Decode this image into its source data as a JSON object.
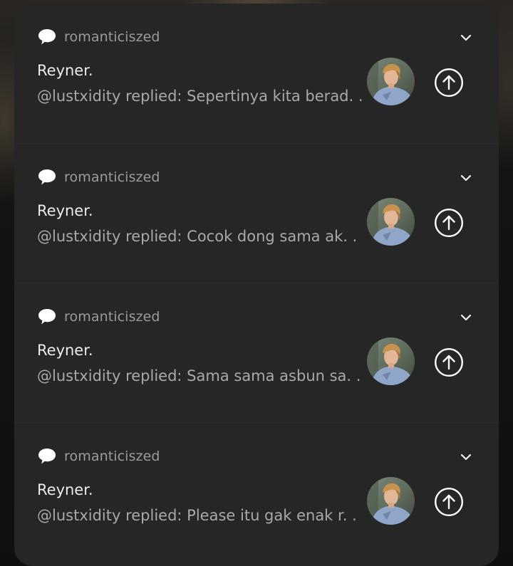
{
  "notifications": [
    {
      "app_name": "romanticiszed",
      "app_icon": "speech-bubble-icon",
      "sender": "Reyner.",
      "message": "@lustxidity replied: Sepertinya kita berad. .",
      "avatar": "profile-avatar"
    },
    {
      "app_name": "romanticiszed",
      "app_icon": "speech-bubble-icon",
      "sender": "Reyner.",
      "message": "@lustxidity replied: Cocok dong sama ak. .",
      "avatar": "profile-avatar"
    },
    {
      "app_name": "romanticiszed",
      "app_icon": "speech-bubble-icon",
      "sender": "Reyner.",
      "message": "@lustxidity replied: Sama sama asbun sa. .",
      "avatar": "profile-avatar"
    },
    {
      "app_name": "romanticiszed",
      "app_icon": "speech-bubble-icon",
      "sender": "Reyner.",
      "message": "@lustxidity replied: Please itu gak enak r. .",
      "avatar": "profile-avatar"
    }
  ],
  "colors": {
    "panel": "#262626",
    "title": "#ececec",
    "message": "#a9a9a9",
    "app_name": "#9b9b9b",
    "icon": "#ffffff"
  }
}
